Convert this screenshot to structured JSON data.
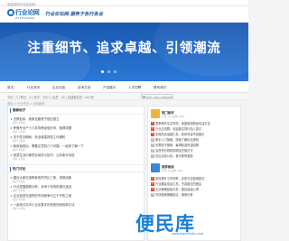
{
  "topbar": {
    "text": "欢迎来到行业论坛网！"
  },
  "header": {
    "logo_cn": "行业论网",
    "logo_en": "HYLTDUNAN",
    "slogan": "行业论坛网 服务于各行各业"
  },
  "banner": {
    "title": "注重细节、追求卓越、引领潮流"
  },
  "nav": {
    "items": [
      "首页",
      "行业资讯",
      "企业动态",
      "技术交流",
      "产品展示",
      "人才招聘",
      "联系我们"
    ]
  },
  "infobar": {
    "left": "今日：0 | 昨日：0 | 帖子：3321 | 会员：42 | 欢迎新会员：xlz1号",
    "search_placeholder": "搜索: 请输入搜索内容"
  },
  "crumb": "首页 > 行业资讯 > 论坛版块",
  "left": {
    "section1": "最新帖子",
    "items1": [
      {
        "text": "无惧台风，我家这套房子依旧挺立",
        "meta": "用户 3天前"
      },
      {
        "text": "养殖专业户十几年饲养经验分享，值得收藏",
        "meta": "用户 3天前"
      },
      {
        "text": "关于防汛期间，安全隐患排查工作通知",
        "meta": "用户 3天前"
      },
      {
        "text": "新房装修后，需要注意的几个问题，一起来了解一下",
        "meta": "用户 3天前"
      },
      {
        "text": "家居生活中那些实用的小技巧，让你事半功倍",
        "meta": "用户 3天前"
      }
    ],
    "section2": "热门讨论",
    "items2": [
      {
        "text": "建议大家在选购家电时货比三家，谨慎消费",
        "meta": "用户 5天前"
      },
      {
        "text": "行业发展趋势分析，未来十年的机遇与挑战",
        "meta": "用户 5天前"
      },
      {
        "text": "企业如何在激烈的市场竞争中立于不败之地",
        "meta": "用户 5天前"
      },
      {
        "text": "一起来讨论中小企业数字化转型的经验和方法",
        "meta": "用户 5天前"
      }
    ]
  },
  "right": {
    "card1": {
      "title": "热门板块",
      "sub": "今日: 12  主题: 356"
    },
    "items1": [
      {
        "num": "1",
        "text": "夏季养护注意事项，家庭常用物品清洁方法"
      },
      {
        "num": "2",
        "text": "行业交流群，欢迎各位同行加入探讨"
      },
      {
        "num": "3",
        "text": "本周热点话题汇总，精彩内容不容错过"
      },
      {
        "num": "4",
        "text": "新手入门指南，快速了解论坛规则"
      },
      {
        "num": "5",
        "text": "优秀帖子推荐，每周精选内容回顾"
      },
      {
        "num": "6",
        "text": "会员积分规则说明及兑换方式"
      },
      {
        "num": "7",
        "text": "论坛活动公告，参与即有奖励"
      }
    ],
    "card2": {
      "title": "推荐阅读",
      "sub": "今日: 8  主题: 214"
    },
    "items2": [
      {
        "num": "1",
        "text": "如何提升工作效率，这些方法值得尝试"
      },
      {
        "num": "2",
        "text": "行业展会信息汇总，不容错过的盛会"
      },
      {
        "num": "3",
        "text": "企业管理经验分享，团队建设心得"
      },
      {
        "num": "4",
        "text": "市场营销策略探讨，案例分析"
      }
    ]
  },
  "watermark": {
    "title": "便民库",
    "sub": "www.bianminku.com"
  },
  "colors": {
    "brand": "#1f6fbf",
    "banner": "#2a78d6",
    "hot": "#e74c3c"
  }
}
